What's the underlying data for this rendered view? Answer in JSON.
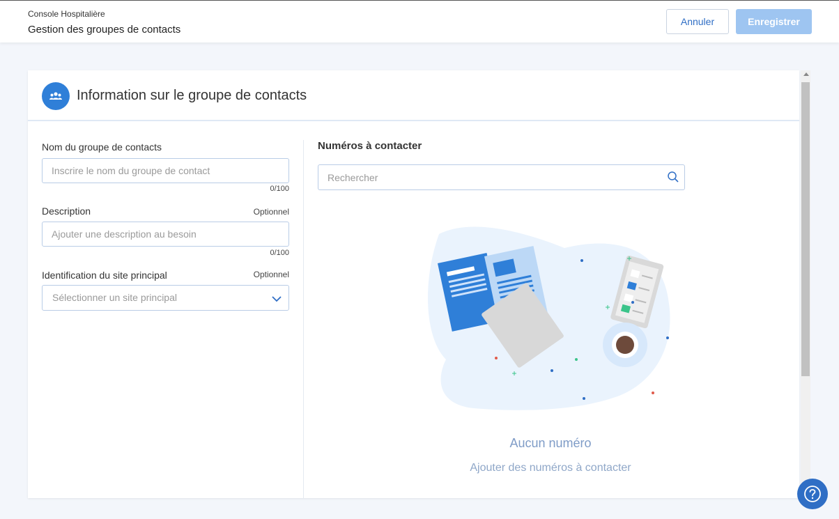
{
  "header": {
    "breadcrumb": "Console Hospitalière",
    "title": "Gestion des groupes de contacts",
    "cancel_label": "Annuler",
    "save_label": "Enregistrer"
  },
  "card": {
    "title": "Information sur le groupe de contacts",
    "icon": "group-icon"
  },
  "form": {
    "name": {
      "label": "Nom du groupe de contacts",
      "placeholder": "Inscrire le nom du groupe de contact",
      "value": "",
      "counter": "0/100"
    },
    "description": {
      "label": "Description",
      "optional": "Optionnel",
      "placeholder": "Ajouter une description au besoin",
      "value": "",
      "counter": "0/100"
    },
    "site": {
      "label": "Identification du site principal",
      "optional": "Optionnel",
      "placeholder": "Sélectionner un site principal"
    }
  },
  "numbers": {
    "title": "Numéros à contacter",
    "search_placeholder": "Rechercher",
    "empty_title": "Aucun numéro",
    "empty_subtitle": "Ajouter des numéros à contacter"
  },
  "colors": {
    "accent": "#2f7fd8",
    "save_disabled": "#9ec5f1",
    "empty_text": "#7f9cc7"
  }
}
